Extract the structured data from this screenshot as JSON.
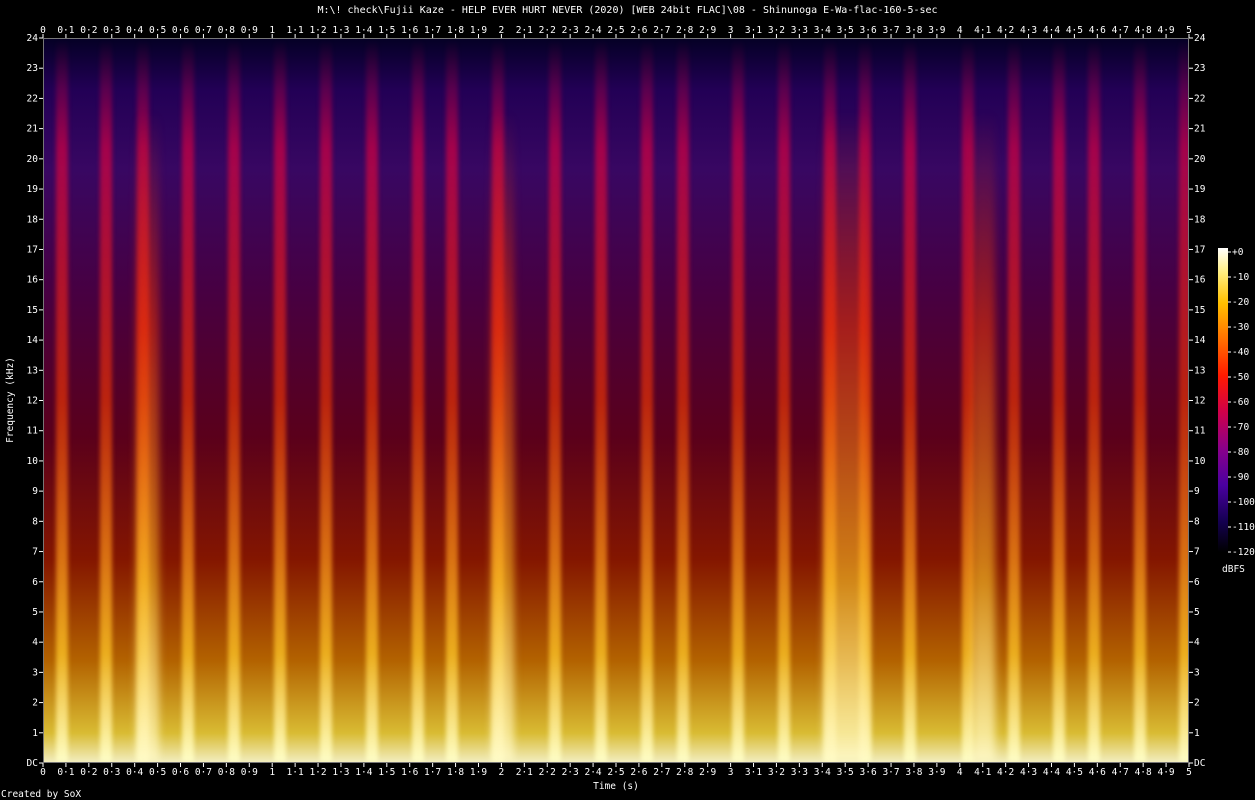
{
  "title": "M:\\! check\\Fujii Kaze - HELP EVER HURT NEVER (2020) [WEB 24bit FLAC]\\08 - Shinunoga E-Wa-flac-160-5-sec",
  "credit": "Created by SoX",
  "colorbar_unit": "dBFS",
  "colorbar_ticks": [
    "+0",
    "-10",
    "-20",
    "-30",
    "-40",
    "-50",
    "-60",
    "-70",
    "-80",
    "-90",
    "-100",
    "-110",
    "-120"
  ],
  "chart_data": {
    "type": "heatmap",
    "title": "M:\\! check\\Fujii Kaze - HELP EVER HURT NEVER (2020) [WEB 24bit FLAC]\\08 - Shinunoga E-Wa-flac-160-5-sec",
    "xlabel": "Time (s)",
    "ylabel": "Frequency (kHz)",
    "xlim": [
      0,
      5
    ],
    "ylim": [
      0,
      24
    ],
    "x_ticks": [
      "0",
      "0·1",
      "0·2",
      "0·3",
      "0·4",
      "0·5",
      "0·6",
      "0·7",
      "0·8",
      "0·9",
      "1",
      "1·1",
      "1·2",
      "1·3",
      "1·4",
      "1·5",
      "1·6",
      "1·7",
      "1·8",
      "1·9",
      "2",
      "2·1",
      "2·2",
      "2·3",
      "2·4",
      "2·5",
      "2·6",
      "2·7",
      "2·8",
      "2·9",
      "3",
      "3·1",
      "3·2",
      "3·3",
      "3·4",
      "3·5",
      "3·6",
      "3·7",
      "3·8",
      "3·9",
      "4",
      "4·1",
      "4·2",
      "4·3",
      "4·4",
      "4·5",
      "4·6",
      "4·7",
      "4·8",
      "4·9",
      "5"
    ],
    "y_ticks": [
      "DC",
      "1",
      "2",
      "3",
      "4",
      "5",
      "6",
      "7",
      "8",
      "9",
      "10",
      "11",
      "12",
      "13",
      "14",
      "15",
      "16",
      "17",
      "18",
      "19",
      "20",
      "21",
      "22",
      "23",
      "24"
    ],
    "color_scale": {
      "unit": "dBFS",
      "min": -120,
      "max": 0,
      "colors": [
        "#000000",
        "#140050",
        "#4a00a0",
        "#8a008a",
        "#d0004a",
        "#ff1a00",
        "#ff7000",
        "#ffc000",
        "#ffee80",
        "#ffffff"
      ]
    },
    "onsets_s": [
      0.08,
      0.27,
      0.43,
      0.63,
      0.83,
      1.03,
      1.23,
      1.43,
      1.63,
      1.78,
      1.98,
      2.23,
      2.43,
      2.63,
      2.79,
      3.03,
      3.23,
      3.43,
      3.58,
      3.78,
      4.03,
      4.23,
      4.43,
      4.58,
      4.78,
      4.98
    ],
    "bright_regions_s": [
      [
        0.4,
        0.5
      ],
      [
        1.95,
        2.05
      ],
      [
        3.4,
        3.6
      ],
      [
        4.05,
        4.15
      ]
    ]
  }
}
